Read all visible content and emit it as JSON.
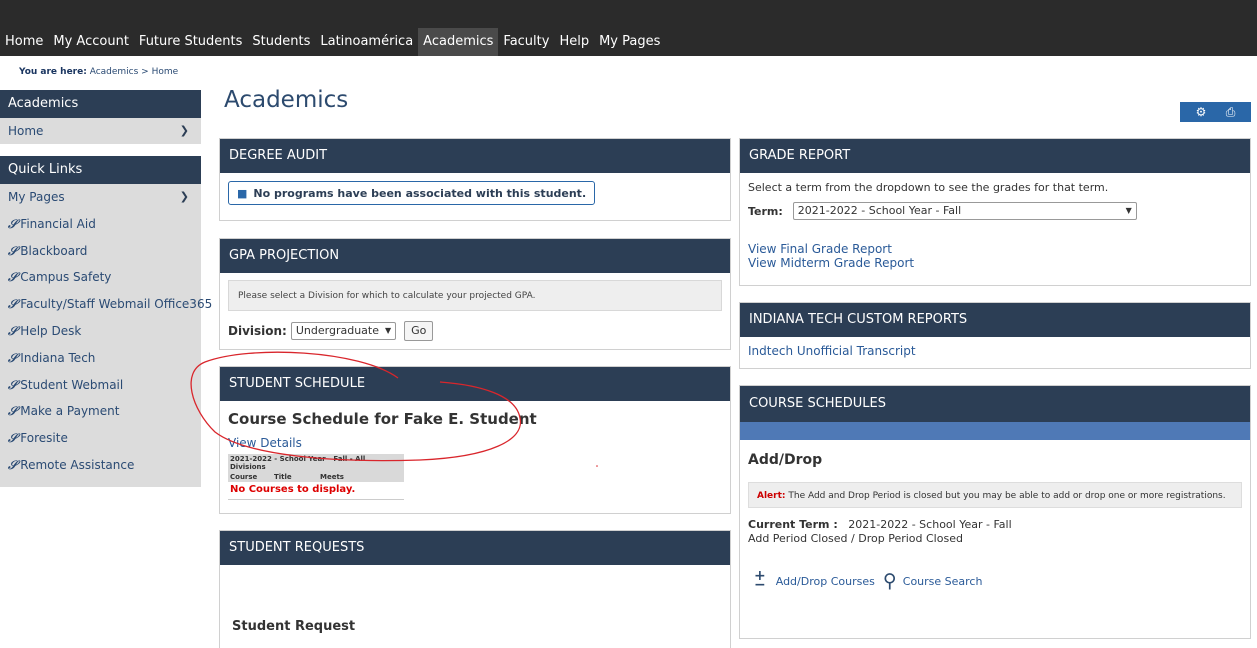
{
  "topnav": [
    "Home",
    "My Account",
    "Future Students",
    "Students",
    "Latinoamérica",
    "Academics",
    "Faculty",
    "Help",
    "My Pages"
  ],
  "breadcrumb": {
    "label": "You are here:",
    "path": "Academics > Home"
  },
  "sidebar": {
    "academics_header": "Academics",
    "home_label": "Home",
    "quick_links_header": "Quick Links",
    "my_pages_label": "My Pages",
    "links": [
      "Financial Aid",
      "Blackboard",
      "Campus Safety",
      "Faculty/Staff Webmail Office365",
      "Help Desk",
      "Indiana Tech",
      "Student Webmail",
      "Make a Payment",
      "Foresite",
      "Remote Assistance"
    ]
  },
  "page_title": "Academics",
  "degree_audit": {
    "header": "DEGREE AUDIT",
    "message": "No programs have been associated with this student."
  },
  "gpa_projection": {
    "header": "GPA PROJECTION",
    "note": "Please select a Division for which to calculate your projected GPA.",
    "division_label": "Division:",
    "division_value": "Undergraduate",
    "go_label": "Go"
  },
  "student_schedule": {
    "header": "STUDENT SCHEDULE",
    "title": "Course Schedule for Fake E. Student",
    "view_details": "View Details",
    "table_title": "2021-2022 - School Year - Fall - All Divisions",
    "columns": [
      "Course",
      "Title",
      "Meets"
    ],
    "empty_message": "No Courses to display."
  },
  "student_requests": {
    "header": "STUDENT REQUESTS",
    "subtitle": "Student Request"
  },
  "grade_report": {
    "header": "GRADE REPORT",
    "description": "Select a term from the dropdown to see the grades for that term.",
    "term_label": "Term:",
    "term_value": "2021-2022 - School Year - Fall",
    "final_link": "View Final Grade Report",
    "midterm_link": "View Midterm Grade Report"
  },
  "custom_reports": {
    "header": "INDIANA TECH CUSTOM REPORTS",
    "transcript_link": "Indtech Unofficial Transcript"
  },
  "course_schedules": {
    "header": "COURSE SCHEDULES",
    "add_drop_title": "Add/Drop",
    "alert_label": "Alert:",
    "alert_text": "The Add and Drop Period is closed but you may be able to add or drop one or more registrations.",
    "current_term_label": "Current Term :",
    "current_term_value": "2021-2022 - School Year - Fall",
    "period_status": "Add Period Closed / Drop Period Closed",
    "add_drop_link": "Add/Drop Courses",
    "course_search_link": "Course Search"
  },
  "colors": {
    "header_bg": "#2c3e55",
    "topbar": "#2b2b2b",
    "link": "#2a5a98",
    "annotation": "#d9262c"
  }
}
